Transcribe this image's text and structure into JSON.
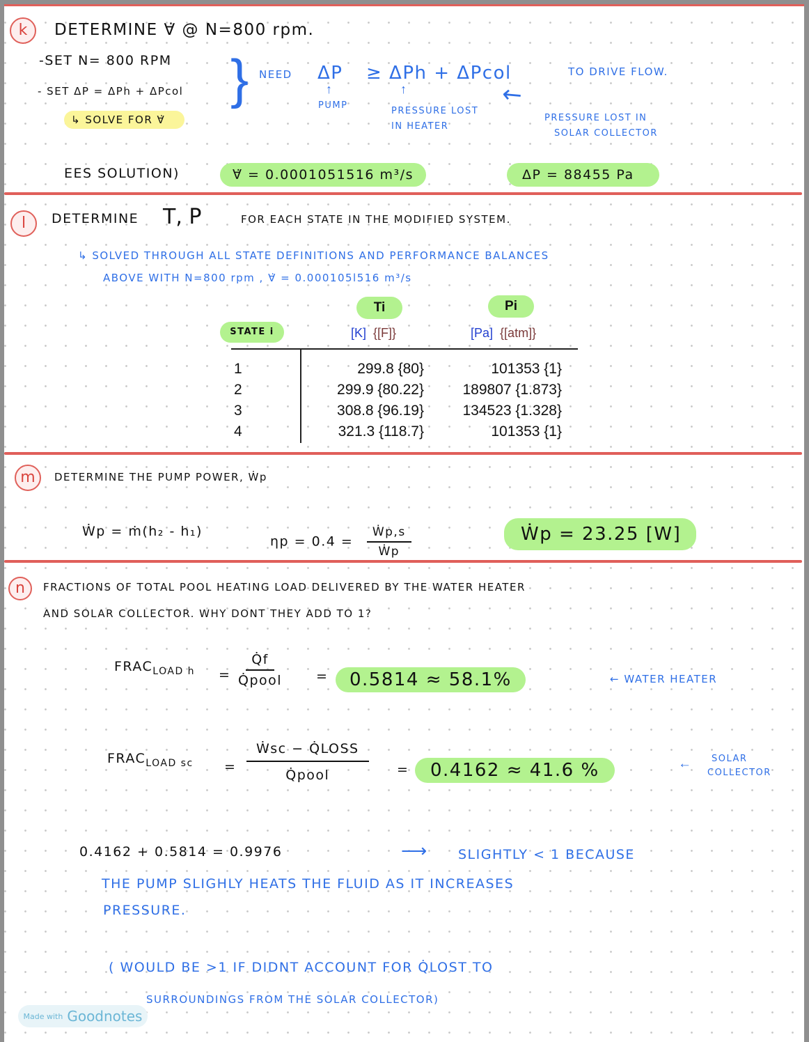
{
  "page": {
    "app_badge": {
      "prefix": "Made with",
      "brand": "Goodnotes"
    },
    "colors": {
      "divider": "#e05f5a",
      "highlight_green": "#b3f28f",
      "highlight_yellow": "#fbf59a",
      "blue_ink": "#2f6fe6",
      "black_ink": "#111111"
    }
  },
  "section_k": {
    "label": "k",
    "title": "DETERMINE ∀̇ @ N=800 rpm.",
    "steps": [
      "-SET  N= 800 RPM",
      "- SET ΔP = ΔPh + ΔPcol",
      "↳ SOLVE FOR ∀̇"
    ],
    "need": "NEED",
    "need_eq_lhs": "ΔP",
    "need_eq_rhs": "≥ ΔPh + ΔPcol",
    "to_drive": "TO  DRIVE  FLOW.",
    "pump_label": "PUMP",
    "heater_label_1": "PRESSURE  LOST",
    "heater_label_2": "IN  HEATER",
    "collector_label_1": "PRESSURE  LOST  IN",
    "collector_label_2": "SOLAR   COLLECTOR",
    "ees_label": "EES  SOLUTION)",
    "result_flow": "∀̇ = 0.0001051516 m³/s",
    "result_dp": "ΔP = 88455  Pa"
  },
  "section_l": {
    "label": "l",
    "title_1": "DETERMINE",
    "title_tp": "T, P",
    "title_2": "FOR  EACH  STATE  IN  THE  MODIFIED  SYSTEM.",
    "note_1": "↳ SOLVED  THROUGH  ALL  STATE  DEFINITIONS  AND  PERFORMANCE  BALANCES",
    "note_2": "ABOVE   WITH   N=800 rpm ,  ∀̇ = 0.000105l516  m³/s",
    "table": {
      "state_header": "STATE i",
      "col_t_header": "Ti",
      "col_p_header": "Pi",
      "col_t_unit_si": "[K]",
      "col_t_unit_alt": "{[F]}",
      "col_p_unit_si": "[Pa]",
      "col_p_unit_alt": "{[atm]}",
      "rows": [
        {
          "state": "1",
          "t": "299.8  {80}",
          "p": "101353  {1}"
        },
        {
          "state": "2",
          "t": "299.9  {80.22}",
          "p": "189807  {1.873}"
        },
        {
          "state": "3",
          "t": "308.8  {96.19}",
          "p": "134523  {1.328}"
        },
        {
          "state": "4",
          "t": "321.3  {118.7}",
          "p": "101353  {1}"
        }
      ]
    }
  },
  "section_m": {
    "label": "m",
    "title": "DETERMINE  THE  PUMP  POWER,  Ẇp",
    "eq1": "Ẇp = ṁ(h₂ - h₁)",
    "eq2_lhs": "ηp = 0.4 =",
    "eq2_num": "Ẇp,s",
    "eq2_den": "Ẇp",
    "result": "Ẇp = 23.25  [W]"
  },
  "section_n": {
    "label": "n",
    "question_1": "FRACTIONS  OF  TOTAL  POOL  HEATING  LOAD   DELIVERED   BY  THE   WATER  HEATER",
    "question_2": "AND   SOLAR  COLLECTOR.  WHY  DONT  THEY  ADD  TO  1?",
    "frac_h_lhs": "FRAC",
    "frac_h_sub": "LOAD h",
    "frac_h_num": "Q̇f",
    "frac_h_den": "Q̇pool",
    "frac_h_result": "0.5814     ≈  58.1%",
    "frac_h_note": "←   WATER  HEATER",
    "frac_sc_lhs": "FRAC",
    "frac_sc_sub": "LOAD sc",
    "frac_sc_num": "Ẇsc − Q̇LOSS",
    "frac_sc_den": "Q̇pool",
    "frac_sc_result": "0.4162    ≈ 41.6 %",
    "frac_sc_note_arrow": "←",
    "frac_sc_note_1": "SOLAR",
    "frac_sc_note_2": "COLLECTOR",
    "sum_eq": "0.4162 +  0.5814   =    0.9976",
    "sum_arrow": "⟶",
    "explain_1": "SLIGHTLY  < 1   BECAUSE",
    "explain_2": "THE  PUMP  SLIGHLY  HEATS   THE   FLUID   AS   IT  INCREASES",
    "explain_3": "PRESSURE.",
    "aside_1": "( WOULD   BE   >1    IF   DIDNT   ACCOUNT   FOR  Q̇LOST   TO",
    "aside_2": "SURROUNDINGS    FROM  THE   SOLAR    COLLECTOR)"
  }
}
